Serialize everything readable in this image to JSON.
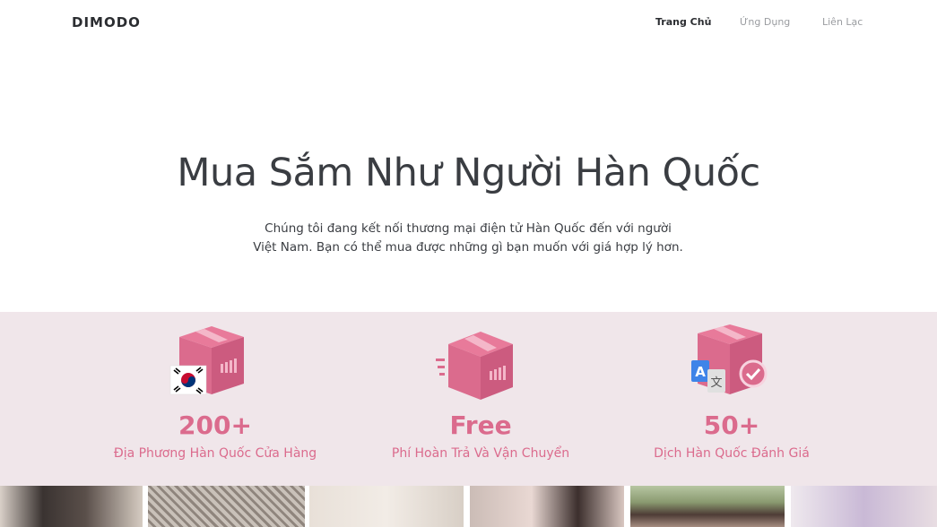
{
  "nav": {
    "logo": "DIMODO",
    "links": [
      "Trang Chủ",
      "Ứng Dụng",
      "Liên Lạc"
    ]
  },
  "hero": {
    "title": "Mua Sắm Như Người Hàn Quốc",
    "subtitle_line1": "Chúng tôi đang kết nối thương mại điện tử Hàn Quốc đến với người",
    "subtitle_line2": "Việt Nam. Bạn có thể mua được những gì bạn muốn với giá hợp lý hơn."
  },
  "features": [
    {
      "icon": "box-korea-flag-icon",
      "stat": "200+",
      "caption": "Địa Phương Hàn Quốc Cửa Hàng"
    },
    {
      "icon": "fast-delivery-box-icon",
      "stat": "Free",
      "caption": "Phí Hoàn Trả Và Vận Chuyển"
    },
    {
      "icon": "box-translate-check-icon",
      "stat": "50+",
      "caption": "Dịch Hàn Quốc Đánh Giá"
    }
  ],
  "colors": {
    "accent": "#db6b8d",
    "features_bg": "#f0e6ea",
    "text": "#3a3d42"
  }
}
